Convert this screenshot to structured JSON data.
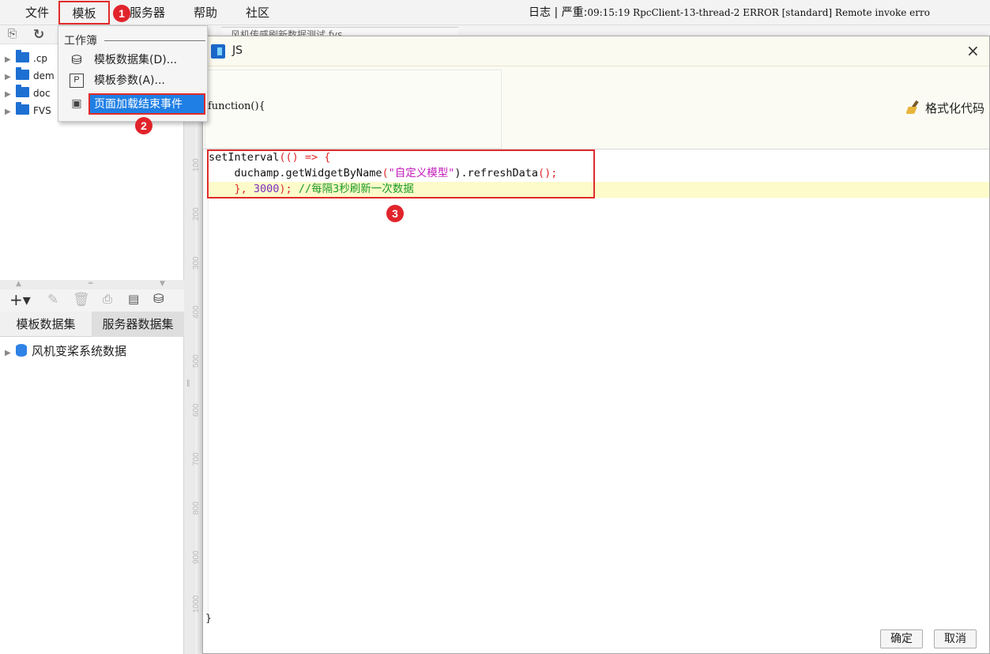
{
  "menubar": {
    "items": [
      "文件",
      "模板",
      "服务器",
      "帮助",
      "社区"
    ],
    "log_label": "日志",
    "log_sep": "|",
    "log_level": "严重:",
    "log_text": "09:15:19 RpcClient-13-thread-2 ERROR [standard] Remote invoke erro"
  },
  "badges": [
    "1",
    "2",
    "3"
  ],
  "dropdown": {
    "section": "工作簿",
    "items": [
      {
        "label": "模板数据集(D)...",
        "icon": "database-icon"
      },
      {
        "label": "模板参数(A)...",
        "icon": "parameter-icon"
      },
      {
        "label": "页面加载结束事件",
        "icon": "event-icon"
      }
    ]
  },
  "file_tree": {
    "items": [
      ".cp",
      "dem",
      "doc",
      "FVS"
    ]
  },
  "background_tab": {
    "label": "风机传感刷新数据测试.fvs"
  },
  "datasets": {
    "tabs": [
      "模板数据集",
      "服务器数据集"
    ],
    "items": [
      "风机变桨系统数据"
    ]
  },
  "dialog": {
    "title": "JS",
    "close": "×",
    "function_signature": "function(){",
    "format_button": "格式化代码",
    "code": {
      "line1": {
        "a": "setInterval",
        "b": "(() => {"
      },
      "line2": {
        "a": "    duchamp.getWidgetByName",
        "b": "(",
        "c": "\"自定义模型\"",
        "d": ").refreshData",
        "e": "();"
      },
      "line3": {
        "a": "    }",
        "b": ", ",
        "c": "3000",
        "d": ");",
        "e": " //每隔3秒刷新一次数据"
      }
    },
    "closing_brace": "}",
    "ruler": [
      "100",
      "200",
      "300",
      "400",
      "500",
      "600",
      "700",
      "800",
      "900",
      "1000"
    ],
    "ok_label": "确定",
    "cancel_label": "取消"
  },
  "colors": {
    "annotation_red": "#e02b2b",
    "selection_blue": "#1f7fe4",
    "highlight_yellow": "#fcfbc9",
    "folder_blue": "#1d6fd2"
  }
}
